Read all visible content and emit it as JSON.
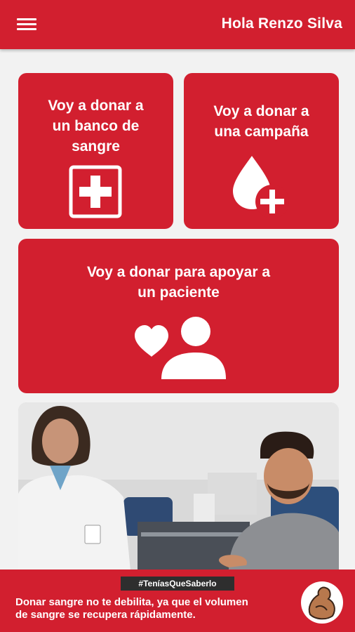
{
  "header": {
    "greeting": "Hola Renzo Silva",
    "menu_icon": "hamburger-menu-icon"
  },
  "options": [
    {
      "label": "Voy a donar a\nun banco de\nsangre",
      "icon": "hospital-cross-icon"
    },
    {
      "label": "Voy a donar a\nuna campaña",
      "icon": "blood-drop-plus-icon"
    },
    {
      "label": "Voy a donar para apoyar a\nun paciente",
      "icon": "heart-person-icon"
    }
  ],
  "banner": {
    "hashtag": "#TeníasQueSaberlo",
    "text": "Donar sangre no te debilita, ya que el volumen\nde sangre se recupera rápidamente."
  },
  "colors": {
    "brand": "#d21f2f",
    "background": "#f2f2f2"
  }
}
